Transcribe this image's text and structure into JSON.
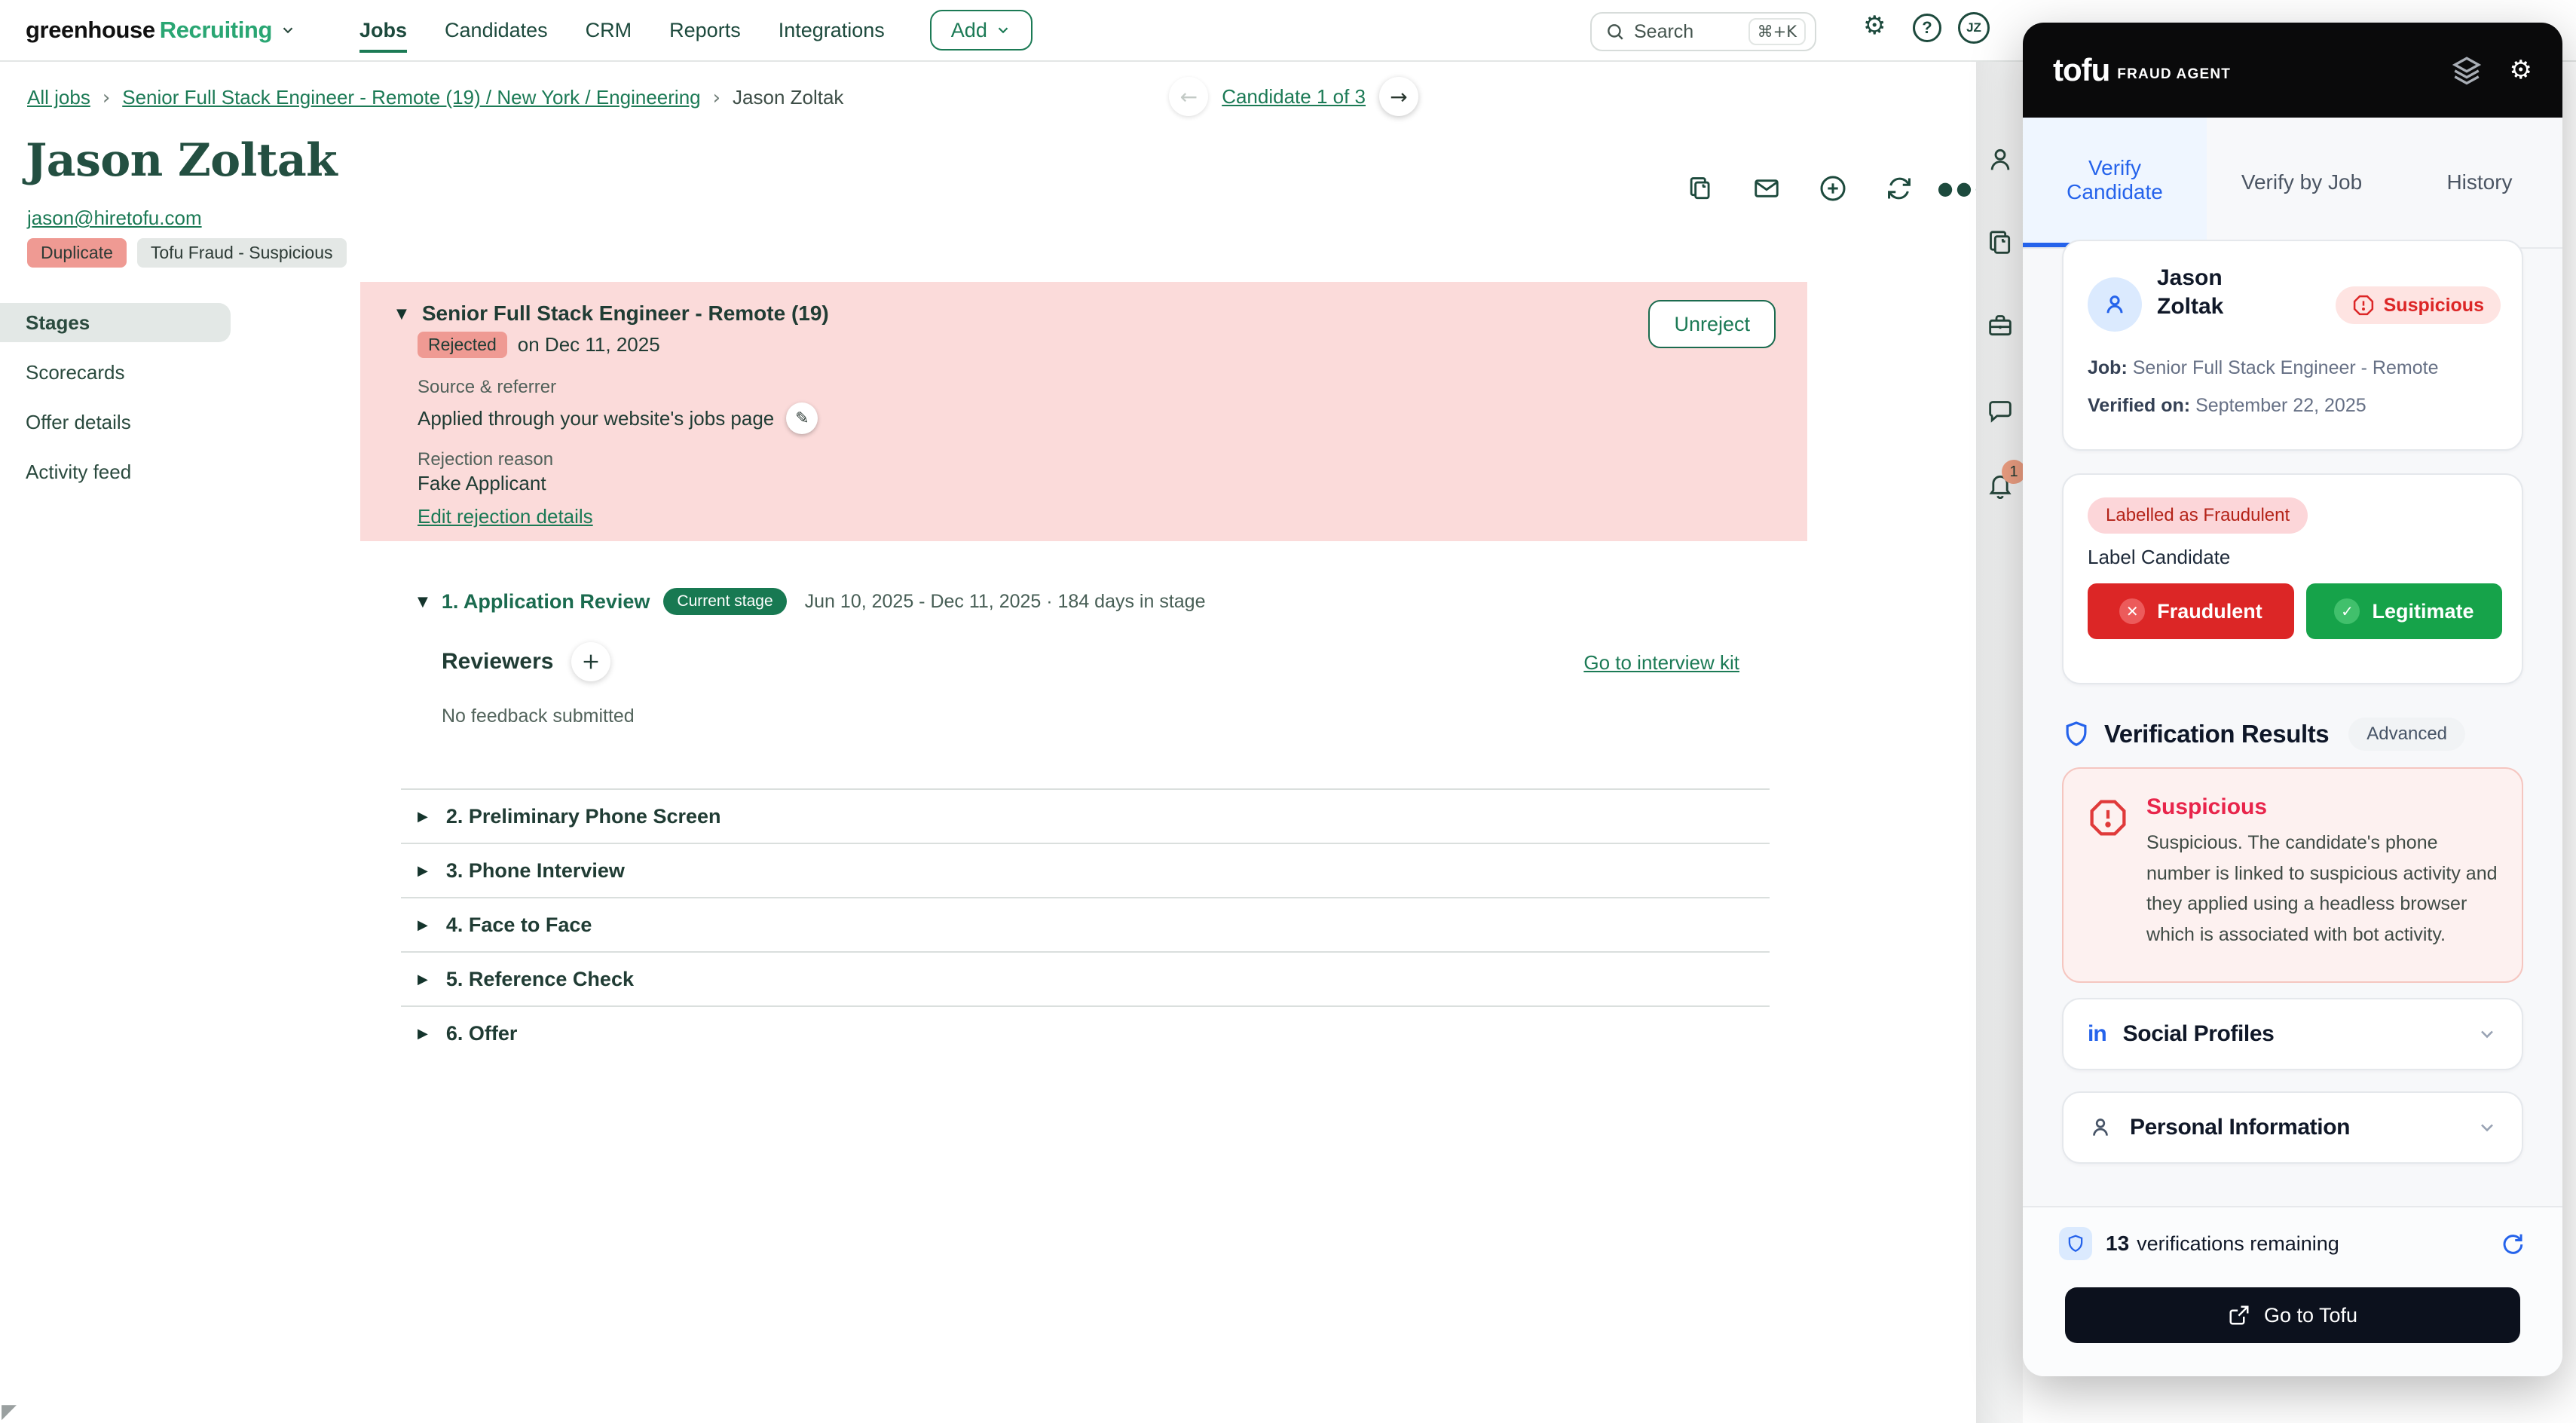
{
  "colors": {
    "accent_blue": "#2563eb",
    "danger_red": "#dc2626",
    "success_green": "#16a34a",
    "greenhouse_green": "#1b7a55",
    "banner_pink": "#fbdbda",
    "salmon": "#ef9a93"
  },
  "nav": {
    "brand_black": "greenhouse",
    "brand_green": "Recruiting",
    "items": [
      "Jobs",
      "Candidates",
      "CRM",
      "Reports",
      "Integrations"
    ],
    "add_label": "Add",
    "search_label": "Search",
    "search_shortcut": "⌘+K",
    "avatar": "JZ"
  },
  "breadcrumb": {
    "all_jobs": "All jobs",
    "job": "Senior Full Stack Engineer - Remote (19) / New York / Engineering",
    "candidate": "Jason Zoltak",
    "sep": "›",
    "pager": "Candidate 1 of 3",
    "prev_arrow": "←",
    "next_arrow": "→"
  },
  "header": {
    "name": "Jason Zoltak",
    "email": "jason@hiretofu.com",
    "tags": [
      "Duplicate",
      "Tofu Fraud - Suspicious"
    ]
  },
  "sidebar": {
    "items": [
      "Stages",
      "Scorecards",
      "Offer details",
      "Activity feed"
    ]
  },
  "rejection": {
    "expander": "▼",
    "job_title": "Senior Full Stack Engineer - Remote (19)",
    "status_badge": "Rejected",
    "date": "on Dec 11, 2025",
    "unreject_label": "Unreject",
    "source_label": "Source & referrer",
    "source_value": "Applied through your website's jobs page",
    "pencil": "✎",
    "reason_label": "Rejection reason",
    "reason_value": "Fake Applicant",
    "edit_link": "Edit rejection details"
  },
  "stage": {
    "expander": "▼",
    "title": "1. Application Review",
    "badge": "Current stage",
    "dates": "Jun 10, 2025 - Dec 11, 2025  ·  184 days in stage",
    "reviewers_label": "Reviewers",
    "kit_link": "Go to interview kit",
    "feedback": "No feedback submitted"
  },
  "collapsed_stages": {
    "expander": "▶",
    "items": [
      "2. Preliminary Phone Screen",
      "3. Phone Interview",
      "4. Face to Face",
      "5. Reference Check",
      "6. Offer"
    ]
  },
  "rail": {
    "bell_badge": "1"
  },
  "tofu": {
    "brand": "tofu",
    "brand_suffix": "FRAUD AGENT",
    "tabs": [
      "Verify Candidate",
      "Verify by Job",
      "History"
    ],
    "candidate_card": {
      "name": "Jason Zoltak",
      "status": "Suspicious",
      "job_label": "Job:",
      "job_value": "Senior Full Stack Engineer - Remote",
      "verified_label": "Verified on:",
      "verified_value": "September 22, 2025"
    },
    "label_card": {
      "status_pill": "Labelled as Fraudulent",
      "title": "Label Candidate",
      "fraudulent_label": "Fraudulent",
      "fraudulent_icon": "✕",
      "legitimate_label": "Legitimate",
      "legitimate_icon": "✓"
    },
    "results": {
      "title": "Verification Results",
      "advanced_label": "Advanced",
      "alert_title": "Suspicious",
      "alert_body": "Suspicious. The candidate's phone number is linked to suspicious activity and they applied using a headless browser which is associated with bot activity."
    },
    "sections": {
      "social": "Social Profiles",
      "personal": "Personal Information",
      "linkedin_glyph": "in"
    },
    "footer": {
      "count": "13",
      "count_suffix": "verifications remaining",
      "cta": "Go to Tofu"
    }
  }
}
